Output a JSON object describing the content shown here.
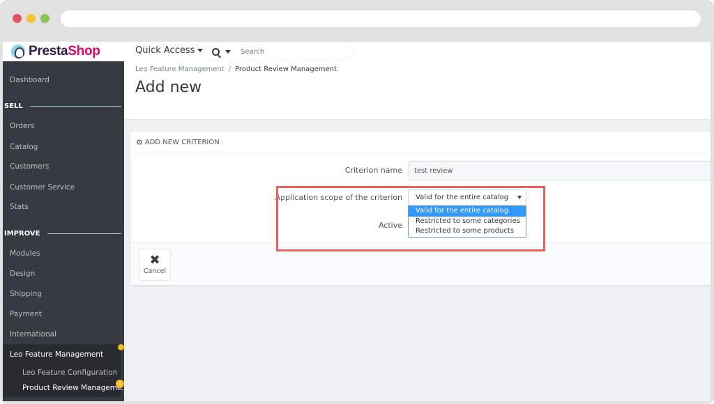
{
  "window": {
    "controls": [
      "close",
      "minimize",
      "maximize"
    ]
  },
  "header": {
    "logo": {
      "presta": "Presta",
      "shop": "Shop"
    },
    "quick_access_label": "Quick Access",
    "search_placeholder": "Search"
  },
  "sidebar": {
    "dashboard": "Dashboard",
    "sections": [
      {
        "title": "SELL",
        "items": [
          "Orders",
          "Catalog",
          "Customers",
          "Customer Service",
          "Stats"
        ]
      },
      {
        "title": "IMPROVE",
        "items": [
          "Modules",
          "Design",
          "Shipping",
          "Payment",
          "International"
        ]
      }
    ],
    "active_parent": "Leo Feature Management",
    "sub_items": [
      "Leo Feature Configuration",
      "Product Review Manageme..."
    ],
    "sub_badge_count": "1"
  },
  "page": {
    "breadcrumb": [
      "Leo Feature Management",
      "Product Review Management"
    ],
    "breadcrumb_separator": "/",
    "title": "Add new"
  },
  "panel": {
    "heading": "ADD NEW CRITERION",
    "heading_icon": "cogs-icon",
    "fields": {
      "criterion_name": {
        "label": "Criterion name",
        "value": "test review"
      },
      "scope": {
        "label": "Application scope of the criterion",
        "selected": "Valid for the entire catalog",
        "options": [
          "Valid for the entire catalog",
          "Restricted to some categories",
          "Restricted to some products"
        ]
      },
      "active": {
        "label": "Active"
      }
    },
    "cancel_label": "Cancel"
  },
  "colors": {
    "sidebar_bg": "#363a41",
    "accent_pink": "#df0067",
    "highlight": "#e8625e",
    "selected_option": "#3399ff",
    "badge": "#fbbb22"
  }
}
